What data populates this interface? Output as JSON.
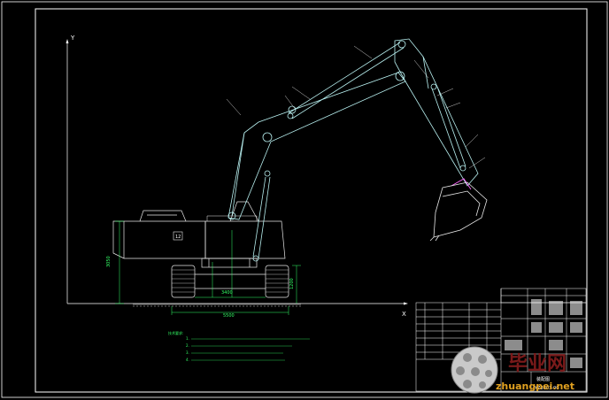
{
  "drawing": {
    "axis_y_label": "Y",
    "axis_x_label": "X",
    "colors": {
      "background": "#000000",
      "frame": "#ffffff",
      "machine": "#e8e8e8",
      "boom": "#b8f0f0",
      "dimension": "#33ff66",
      "highlight": "#ff66ff"
    },
    "dimensions": {
      "overall_length": "5500",
      "track_gauge": "3400",
      "height_left": "3050",
      "height_right": "1200",
      "counterweight_label": "12"
    },
    "notes_heading": "技术要求:",
    "notes": [
      "1.",
      "2.",
      "3.",
      "4."
    ]
  },
  "title_block": {
    "title": "装配图",
    "drawing_no": "YZ3603-00"
  },
  "watermark": {
    "text_cn": "毕业网",
    "url": "zhuangpei.net"
  }
}
